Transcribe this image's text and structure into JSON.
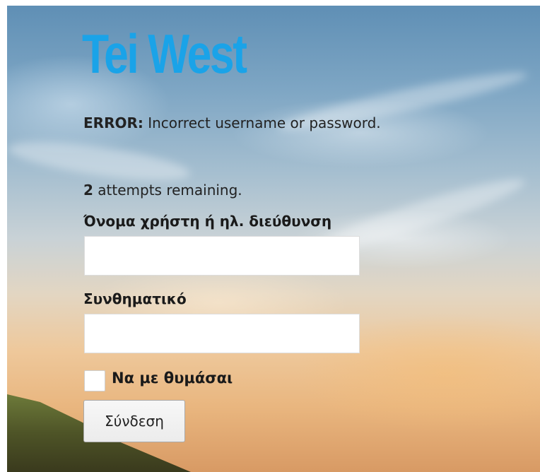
{
  "brand": {
    "logo_text": "Tei West",
    "logo_color": "#1aa3e8"
  },
  "messages": {
    "error_label": "ERROR:",
    "error_text": " Incorrect username or password.",
    "attempts_count": "2",
    "attempts_text": " attempts remaining."
  },
  "form": {
    "username_label": "Όνομα χρήστη ή ηλ. διεύθυνση",
    "username_value": "",
    "password_label": "Συνθηματικό",
    "password_value": "",
    "remember_label": "Να με θυμάσαι",
    "remember_checked": false,
    "submit_label": "Σύνδεση"
  }
}
